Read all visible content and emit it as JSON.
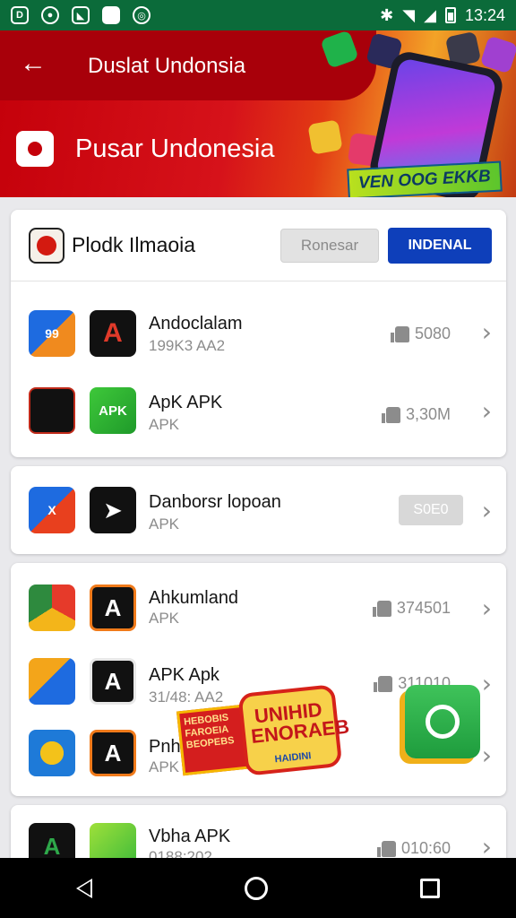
{
  "status_bar": {
    "time": "13:24",
    "icons": [
      "notification-d-icon",
      "record-icon",
      "image-icon",
      "file-icon",
      "camera-icon",
      "bluetooth-icon",
      "wifi-icon",
      "signal-icon",
      "battery-icon"
    ]
  },
  "header": {
    "title": "Duslat Undonsia",
    "subtitle": "Pusar Undonesia",
    "promo": "VEN OOG EKKB"
  },
  "card1": {
    "title": "Plodk Ilmaoia",
    "grey_button": "Ronesar",
    "blue_button": "INDENAL",
    "items": [
      {
        "name": "Andoclalam",
        "sub": "199K3 AA2",
        "meta": "5080",
        "icon_a": "A",
        "icon_b": "A"
      },
      {
        "name": "ApK APK",
        "sub": "APK",
        "meta": "3,30M",
        "icon_a": "",
        "icon_b": "APK"
      }
    ]
  },
  "card2": {
    "items": [
      {
        "name": "Danborsr lopoan",
        "sub": "APK",
        "button": "S0E0"
      }
    ]
  },
  "card3": {
    "items": [
      {
        "name": "Ahkumland",
        "sub": "APK",
        "meta": "374501"
      },
      {
        "name": "APK Apk",
        "sub": "31/48: AA2",
        "meta": "311010"
      },
      {
        "name": "Pnh",
        "sub": "APK",
        "meta": ""
      }
    ]
  },
  "card4": {
    "items": [
      {
        "name": "Vbha APK",
        "sub": "0188:202",
        "meta": "010:60"
      }
    ]
  },
  "sticker": {
    "left_text": "HEBOBIS FAROEIA BEOPEBS",
    "main_text": "UNIHID ENORAEB",
    "tag": "HAIDINI"
  },
  "colors": {
    "status_bar": "#0b6b3a",
    "header_red": "#c4000a",
    "accent_blue": "#0e3fba",
    "text_grey": "#8c8c8c"
  },
  "nav": {
    "icons": [
      "back-icon",
      "home-icon",
      "recents-icon"
    ]
  }
}
